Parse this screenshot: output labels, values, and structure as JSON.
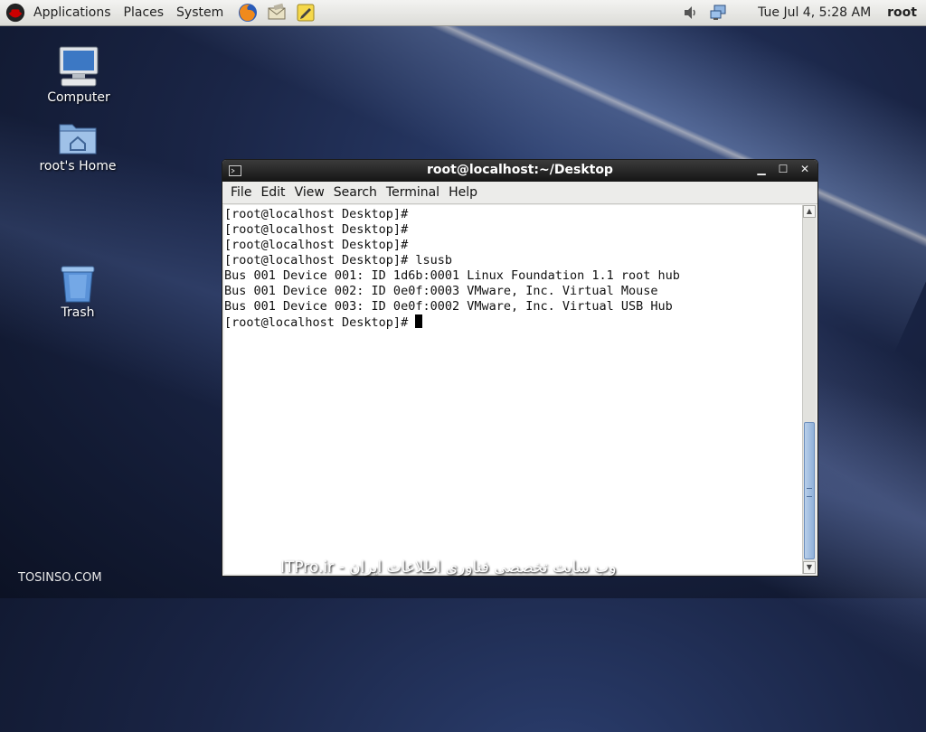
{
  "panel": {
    "menus": [
      "Applications",
      "Places",
      "System"
    ],
    "clock": "Tue Jul  4,  5:28 AM",
    "user": "root"
  },
  "desktop_icons": [
    {
      "label": "Computer",
      "icon": "computer-icon"
    },
    {
      "label": "root's Home",
      "icon": "home-folder-icon"
    },
    {
      "label": "Trash",
      "icon": "trash-icon"
    }
  ],
  "terminal": {
    "title": "root@localhost:~/Desktop",
    "menu": [
      "File",
      "Edit",
      "View",
      "Search",
      "Terminal",
      "Help"
    ],
    "lines": [
      "[root@localhost Desktop]#",
      "[root@localhost Desktop]#",
      "[root@localhost Desktop]#",
      "[root@localhost Desktop]# lsusb",
      "Bus 001 Device 001: ID 1d6b:0001 Linux Foundation 1.1 root hub",
      "Bus 001 Device 002: ID 0e0f:0003 VMware, Inc. Virtual Mouse",
      "Bus 001 Device 003: ID 0e0f:0002 VMware, Inc. Virtual USB Hub",
      "[root@localhost Desktop]# "
    ]
  },
  "watermarks": {
    "center": "ITPro.ir - وب سایت تخصصی فناوری اطلاعات ایران",
    "corner": "TOSINSO.COM"
  },
  "colors": {
    "redhat": "#cc0000",
    "scroll_thumb": "#8fb1da"
  }
}
